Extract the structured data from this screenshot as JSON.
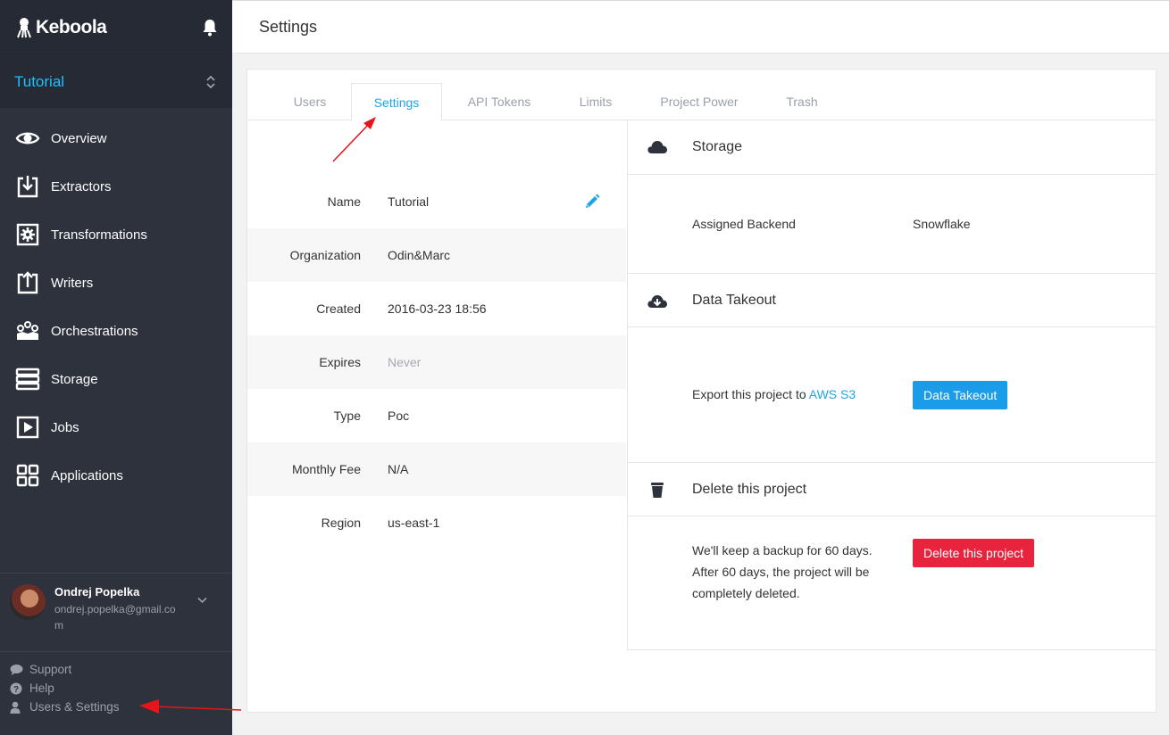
{
  "sidebar": {
    "brand": "Keboola",
    "project": "Tutorial",
    "items": [
      {
        "label": "Overview"
      },
      {
        "label": "Extractors"
      },
      {
        "label": "Transformations"
      },
      {
        "label": "Writers"
      },
      {
        "label": "Orchestrations"
      },
      {
        "label": "Storage"
      },
      {
        "label": "Jobs"
      },
      {
        "label": "Applications"
      }
    ],
    "user": {
      "name": "Ondrej Popelka",
      "email": "ondrej.popelka@gmail.com"
    },
    "footer": [
      {
        "label": "Support"
      },
      {
        "label": "Help"
      },
      {
        "label": "Users & Settings"
      }
    ]
  },
  "header": {
    "title": "Settings"
  },
  "tabs": [
    {
      "label": "Users"
    },
    {
      "label": "Settings"
    },
    {
      "label": "API Tokens"
    },
    {
      "label": "Limits"
    },
    {
      "label": "Project Power"
    },
    {
      "label": "Trash"
    }
  ],
  "active_tab": "Settings",
  "properties": [
    {
      "label": "Name",
      "value": "Tutorial"
    },
    {
      "label": "Organization",
      "value": "Odin&Marc"
    },
    {
      "label": "Created",
      "value": "2016-03-23 18:56"
    },
    {
      "label": "Expires",
      "value": "Never"
    },
    {
      "label": "Type",
      "value": "Poc"
    },
    {
      "label": "Monthly Fee",
      "value": "N/A"
    },
    {
      "label": "Region",
      "value": "us-east-1"
    }
  ],
  "storage": {
    "title": "Storage",
    "label": "Assigned Backend",
    "value": "Snowflake"
  },
  "takeout": {
    "title": "Data Takeout",
    "text": "Export this project to",
    "link": "AWS S3",
    "button": "Data Takeout"
  },
  "delete": {
    "title": "Delete this project",
    "lines": [
      "We'll keep a backup for 60 days.",
      "After 60 days, the project will be",
      "completely deleted."
    ],
    "button": "Delete this project"
  },
  "colors": {
    "sidebar": "#2d323d",
    "accent": "#1ec0ff",
    "primary_button": "#1b9ce8",
    "danger_button": "#e8233d",
    "annotation_arrow": "#e8141c"
  }
}
